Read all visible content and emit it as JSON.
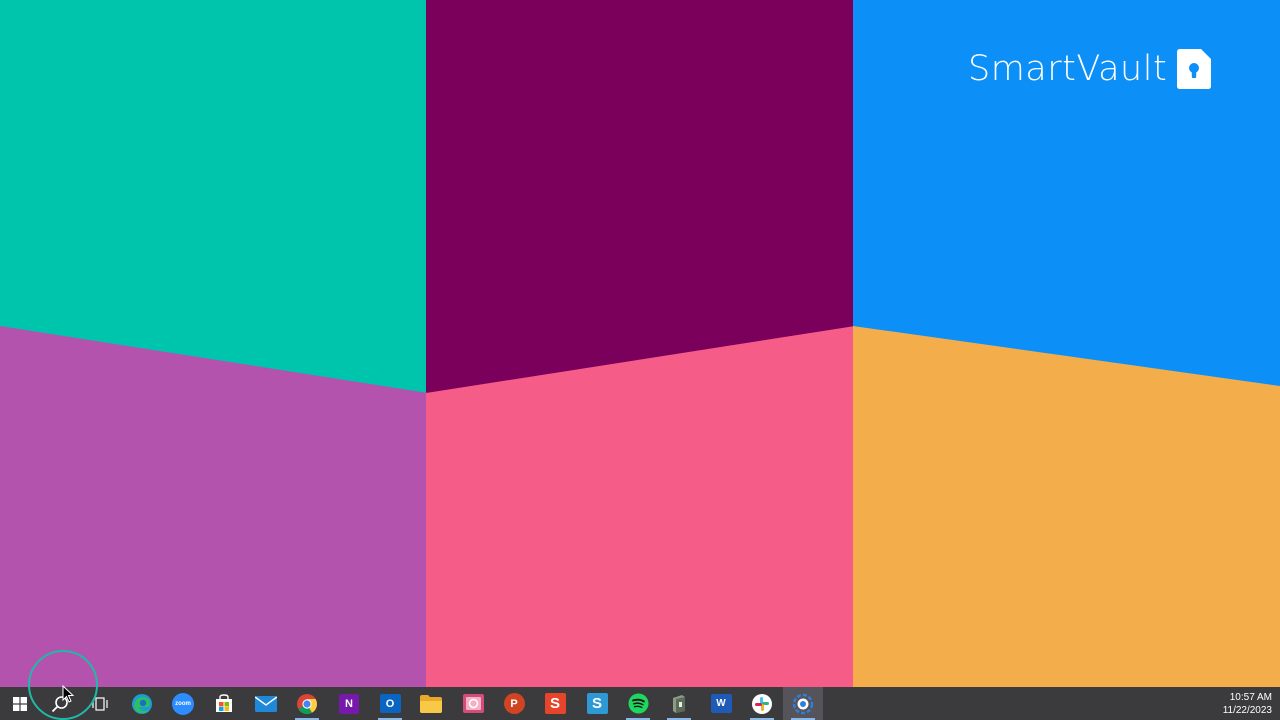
{
  "wallpaper": {
    "colors": {
      "teal": "#00c5ad",
      "plum": "#7a005c",
      "blue": "#0d8ff8",
      "orchid": "#b453ad",
      "rose": "#f55c87",
      "amber": "#f3ae4b"
    },
    "brand": {
      "name": "SmartVault",
      "logo_icon": "document-keyhole-icon",
      "color": "#ffffff"
    }
  },
  "taskbar": {
    "background": "#3b3a3d",
    "items": [
      {
        "name": "start-button",
        "icon": "windows-logo-icon",
        "label": "Start"
      },
      {
        "name": "search-button",
        "icon": "search-icon",
        "label": "Search"
      },
      {
        "name": "task-view-button",
        "icon": "task-view-icon",
        "label": "Task View"
      },
      {
        "name": "edge-button",
        "icon": "edge-icon",
        "label": "Microsoft Edge"
      },
      {
        "name": "zoom-button",
        "icon": "zoom-icon",
        "label": "zoom"
      },
      {
        "name": "store-button",
        "icon": "store-icon",
        "label": "Microsoft Store"
      },
      {
        "name": "mail-button",
        "icon": "mail-icon",
        "label": "Mail"
      },
      {
        "name": "chrome-button",
        "icon": "chrome-icon",
        "label": "Google Chrome"
      },
      {
        "name": "onenote-button",
        "icon": "onenote-icon",
        "label": "OneNote"
      },
      {
        "name": "outlook-button",
        "icon": "outlook-icon",
        "label": "Outlook"
      },
      {
        "name": "file-explorer-button",
        "icon": "folder-icon",
        "label": "File Explorer"
      },
      {
        "name": "photos-button",
        "icon": "photos-icon",
        "label": "Photos"
      },
      {
        "name": "powerpoint-button",
        "icon": "powerpoint-icon",
        "label": "PowerPoint"
      },
      {
        "name": "snagit-button",
        "icon": "snagit-icon",
        "label": "Snagit"
      },
      {
        "name": "app-s-button",
        "icon": "s-app-icon",
        "label": "S"
      },
      {
        "name": "spotify-button",
        "icon": "spotify-icon",
        "label": "Spotify"
      },
      {
        "name": "app-green-button",
        "icon": "green-app-icon",
        "label": "App"
      },
      {
        "name": "word-button",
        "icon": "word-icon",
        "label": "Word"
      },
      {
        "name": "slack-button",
        "icon": "slack-icon",
        "label": "Slack"
      },
      {
        "name": "smartvault-button",
        "icon": "smartvault-app-icon",
        "label": "SmartVault"
      }
    ],
    "zoom_label": "zoom",
    "onenote_letter": "N",
    "outlook_letter": "O",
    "powerpoint_letter": "P",
    "snagit_letter": "S",
    "sapp_letter": "S",
    "word_letter": "W"
  },
  "tray": {
    "time": "10:57 AM",
    "date": "11/22/2023"
  }
}
